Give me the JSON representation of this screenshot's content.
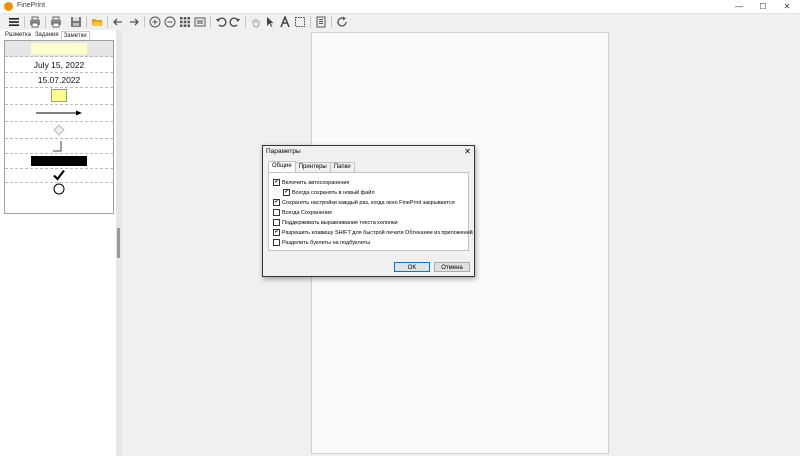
{
  "window": {
    "title": "FinePrint",
    "controls": [
      "—",
      "☐",
      "✕"
    ]
  },
  "left_panel": {
    "tabs": [
      "Разметка",
      "Задания",
      "Заметки"
    ],
    "active_tab": 2,
    "dates": [
      "July 15, 2022",
      "15.07.2022"
    ]
  },
  "dialog": {
    "title": "Параметры",
    "close": "✕",
    "tabs": [
      "Общие",
      "Принтеры",
      "Папки"
    ],
    "options": [
      {
        "label": "Включить автосохранение",
        "checked": true
      },
      {
        "label": "Всегда сохранять в новый файл",
        "checked": true
      },
      {
        "label": "Сохранять настройки каждый раз, когда окно FinePrint закрывается",
        "checked": true
      },
      {
        "label": "Всегда Сохранение",
        "checked": false
      },
      {
        "label": "Поддерживать выравнивание текста колонки",
        "checked": false
      },
      {
        "label": "Разрешить клавишу SHIFT для быстрой печати Обтекание из приложений",
        "checked": true
      },
      {
        "label": "Разделить буклеты на подбуклеты",
        "checked": false
      }
    ],
    "ok": "OK",
    "cancel": "Отмена"
  },
  "colors": {
    "accent": "#0078d7",
    "note_yellow": "#ffff88",
    "highlight": "#ffffcc"
  }
}
